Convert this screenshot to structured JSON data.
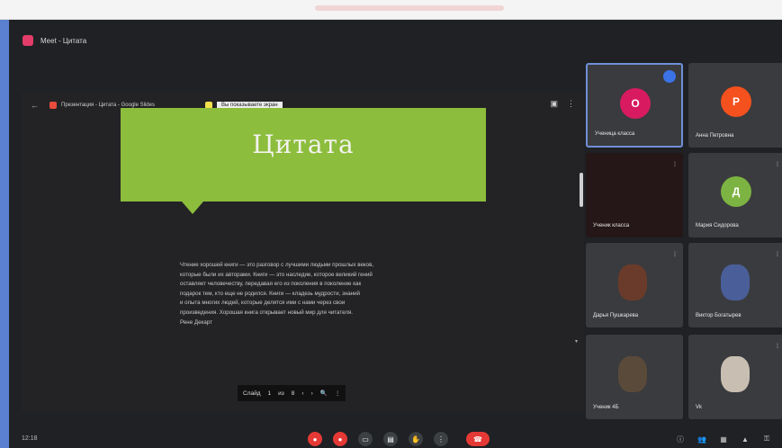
{
  "window": {
    "title": "Meet - Цитата"
  },
  "tabs": [
    {
      "label": "Презентация - Цитата - Google Slides",
      "color": "#e74c3c"
    },
    {
      "label": "Вы показываете экран",
      "color": "#f4e04d"
    }
  ],
  "slide": {
    "title": "Цитата",
    "body_lines": [
      "Чтение хорошей книги — это разговор с лучшими людьми прошлых веков,",
      "которые были их авторами. Книги — это наследие, которое великий гений",
      "оставляет человечеству, передавая его из поколения в поколение как",
      "подарок тем, кто еще не родился. Книги — кладезь мудрости, знаний",
      "и опыта многих людей, которые делятся ими с нами через свои",
      "произведения. Хорошая книга открывает новый мир для читателя.",
      "Рене Декарт"
    ],
    "page_bar": [
      "Слайд",
      "1",
      "из",
      "8",
      "‹",
      "›",
      "🔍",
      "⋮"
    ]
  },
  "participants": [
    {
      "name": "Ученица класса",
      "initial": "О",
      "color": "#d81b60",
      "active": true
    },
    {
      "name": "Анна Петровна",
      "initial": "Р",
      "color": "#f4511e"
    },
    {
      "name": "Ученик класса",
      "initial": "",
      "color": ""
    },
    {
      "name": "Мария Сидорова",
      "initial": "Д",
      "color": "#7cb342"
    },
    {
      "name": "Дарья Пушкарева",
      "initial": "",
      "color": "#6a3b2a"
    },
    {
      "name": "Виктор Богатырев",
      "initial": "",
      "color": "#4a5f9a"
    },
    {
      "name": "Ученик 4Б",
      "initial": "",
      "color": "#5a4a3a"
    },
    {
      "name": "Vk",
      "initial": "",
      "color": "#c8beb2"
    }
  ],
  "controls": {
    "time": "12:18",
    "buttons": [
      {
        "icon": "mic-off-icon",
        "color": "#e53935"
      },
      {
        "icon": "camera-off-icon",
        "color": "#e53935"
      },
      {
        "icon": "captions-icon",
        "color": "#3c4043"
      },
      {
        "icon": "present-icon",
        "color": "#3c4043"
      },
      {
        "icon": "raise-hand-icon",
        "color": "#3c4043"
      },
      {
        "icon": "more-icon",
        "color": "#3c4043"
      },
      {
        "icon": "end-call-icon",
        "color": "#e53935"
      }
    ],
    "right_icons": [
      "info-icon",
      "people-icon",
      "chat-icon",
      "activities-icon",
      "lock-icon"
    ]
  }
}
